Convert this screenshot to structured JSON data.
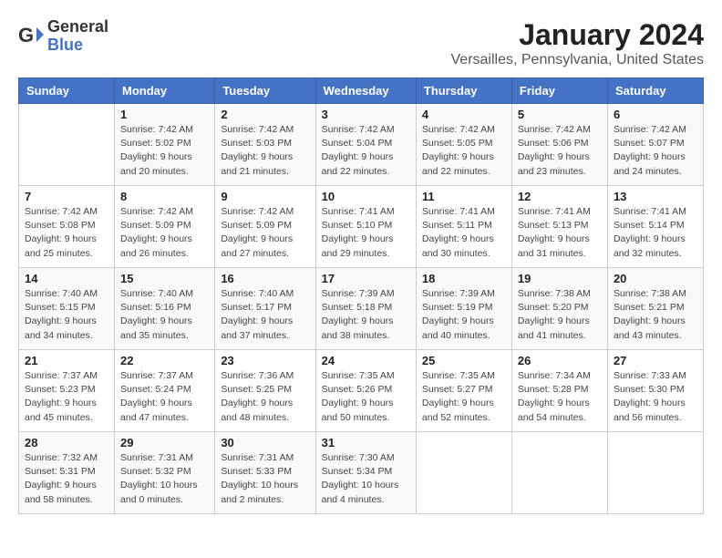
{
  "header": {
    "logo": {
      "general": "General",
      "blue": "Blue"
    },
    "title": "January 2024",
    "location": "Versailles, Pennsylvania, United States"
  },
  "weekdays": [
    "Sunday",
    "Monday",
    "Tuesday",
    "Wednesday",
    "Thursday",
    "Friday",
    "Saturday"
  ],
  "weeks": [
    [
      {
        "day": "",
        "info": ""
      },
      {
        "day": "1",
        "info": "Sunrise: 7:42 AM\nSunset: 5:02 PM\nDaylight: 9 hours\nand 20 minutes."
      },
      {
        "day": "2",
        "info": "Sunrise: 7:42 AM\nSunset: 5:03 PM\nDaylight: 9 hours\nand 21 minutes."
      },
      {
        "day": "3",
        "info": "Sunrise: 7:42 AM\nSunset: 5:04 PM\nDaylight: 9 hours\nand 22 minutes."
      },
      {
        "day": "4",
        "info": "Sunrise: 7:42 AM\nSunset: 5:05 PM\nDaylight: 9 hours\nand 22 minutes."
      },
      {
        "day": "5",
        "info": "Sunrise: 7:42 AM\nSunset: 5:06 PM\nDaylight: 9 hours\nand 23 minutes."
      },
      {
        "day": "6",
        "info": "Sunrise: 7:42 AM\nSunset: 5:07 PM\nDaylight: 9 hours\nand 24 minutes."
      }
    ],
    [
      {
        "day": "7",
        "info": "Sunrise: 7:42 AM\nSunset: 5:08 PM\nDaylight: 9 hours\nand 25 minutes."
      },
      {
        "day": "8",
        "info": "Sunrise: 7:42 AM\nSunset: 5:09 PM\nDaylight: 9 hours\nand 26 minutes."
      },
      {
        "day": "9",
        "info": "Sunrise: 7:42 AM\nSunset: 5:09 PM\nDaylight: 9 hours\nand 27 minutes."
      },
      {
        "day": "10",
        "info": "Sunrise: 7:41 AM\nSunset: 5:10 PM\nDaylight: 9 hours\nand 29 minutes."
      },
      {
        "day": "11",
        "info": "Sunrise: 7:41 AM\nSunset: 5:11 PM\nDaylight: 9 hours\nand 30 minutes."
      },
      {
        "day": "12",
        "info": "Sunrise: 7:41 AM\nSunset: 5:13 PM\nDaylight: 9 hours\nand 31 minutes."
      },
      {
        "day": "13",
        "info": "Sunrise: 7:41 AM\nSunset: 5:14 PM\nDaylight: 9 hours\nand 32 minutes."
      }
    ],
    [
      {
        "day": "14",
        "info": "Sunrise: 7:40 AM\nSunset: 5:15 PM\nDaylight: 9 hours\nand 34 minutes."
      },
      {
        "day": "15",
        "info": "Sunrise: 7:40 AM\nSunset: 5:16 PM\nDaylight: 9 hours\nand 35 minutes."
      },
      {
        "day": "16",
        "info": "Sunrise: 7:40 AM\nSunset: 5:17 PM\nDaylight: 9 hours\nand 37 minutes."
      },
      {
        "day": "17",
        "info": "Sunrise: 7:39 AM\nSunset: 5:18 PM\nDaylight: 9 hours\nand 38 minutes."
      },
      {
        "day": "18",
        "info": "Sunrise: 7:39 AM\nSunset: 5:19 PM\nDaylight: 9 hours\nand 40 minutes."
      },
      {
        "day": "19",
        "info": "Sunrise: 7:38 AM\nSunset: 5:20 PM\nDaylight: 9 hours\nand 41 minutes."
      },
      {
        "day": "20",
        "info": "Sunrise: 7:38 AM\nSunset: 5:21 PM\nDaylight: 9 hours\nand 43 minutes."
      }
    ],
    [
      {
        "day": "21",
        "info": "Sunrise: 7:37 AM\nSunset: 5:23 PM\nDaylight: 9 hours\nand 45 minutes."
      },
      {
        "day": "22",
        "info": "Sunrise: 7:37 AM\nSunset: 5:24 PM\nDaylight: 9 hours\nand 47 minutes."
      },
      {
        "day": "23",
        "info": "Sunrise: 7:36 AM\nSunset: 5:25 PM\nDaylight: 9 hours\nand 48 minutes."
      },
      {
        "day": "24",
        "info": "Sunrise: 7:35 AM\nSunset: 5:26 PM\nDaylight: 9 hours\nand 50 minutes."
      },
      {
        "day": "25",
        "info": "Sunrise: 7:35 AM\nSunset: 5:27 PM\nDaylight: 9 hours\nand 52 minutes."
      },
      {
        "day": "26",
        "info": "Sunrise: 7:34 AM\nSunset: 5:28 PM\nDaylight: 9 hours\nand 54 minutes."
      },
      {
        "day": "27",
        "info": "Sunrise: 7:33 AM\nSunset: 5:30 PM\nDaylight: 9 hours\nand 56 minutes."
      }
    ],
    [
      {
        "day": "28",
        "info": "Sunrise: 7:32 AM\nSunset: 5:31 PM\nDaylight: 9 hours\nand 58 minutes."
      },
      {
        "day": "29",
        "info": "Sunrise: 7:31 AM\nSunset: 5:32 PM\nDaylight: 10 hours\nand 0 minutes."
      },
      {
        "day": "30",
        "info": "Sunrise: 7:31 AM\nSunset: 5:33 PM\nDaylight: 10 hours\nand 2 minutes."
      },
      {
        "day": "31",
        "info": "Sunrise: 7:30 AM\nSunset: 5:34 PM\nDaylight: 10 hours\nand 4 minutes."
      },
      {
        "day": "",
        "info": ""
      },
      {
        "day": "",
        "info": ""
      },
      {
        "day": "",
        "info": ""
      }
    ]
  ]
}
